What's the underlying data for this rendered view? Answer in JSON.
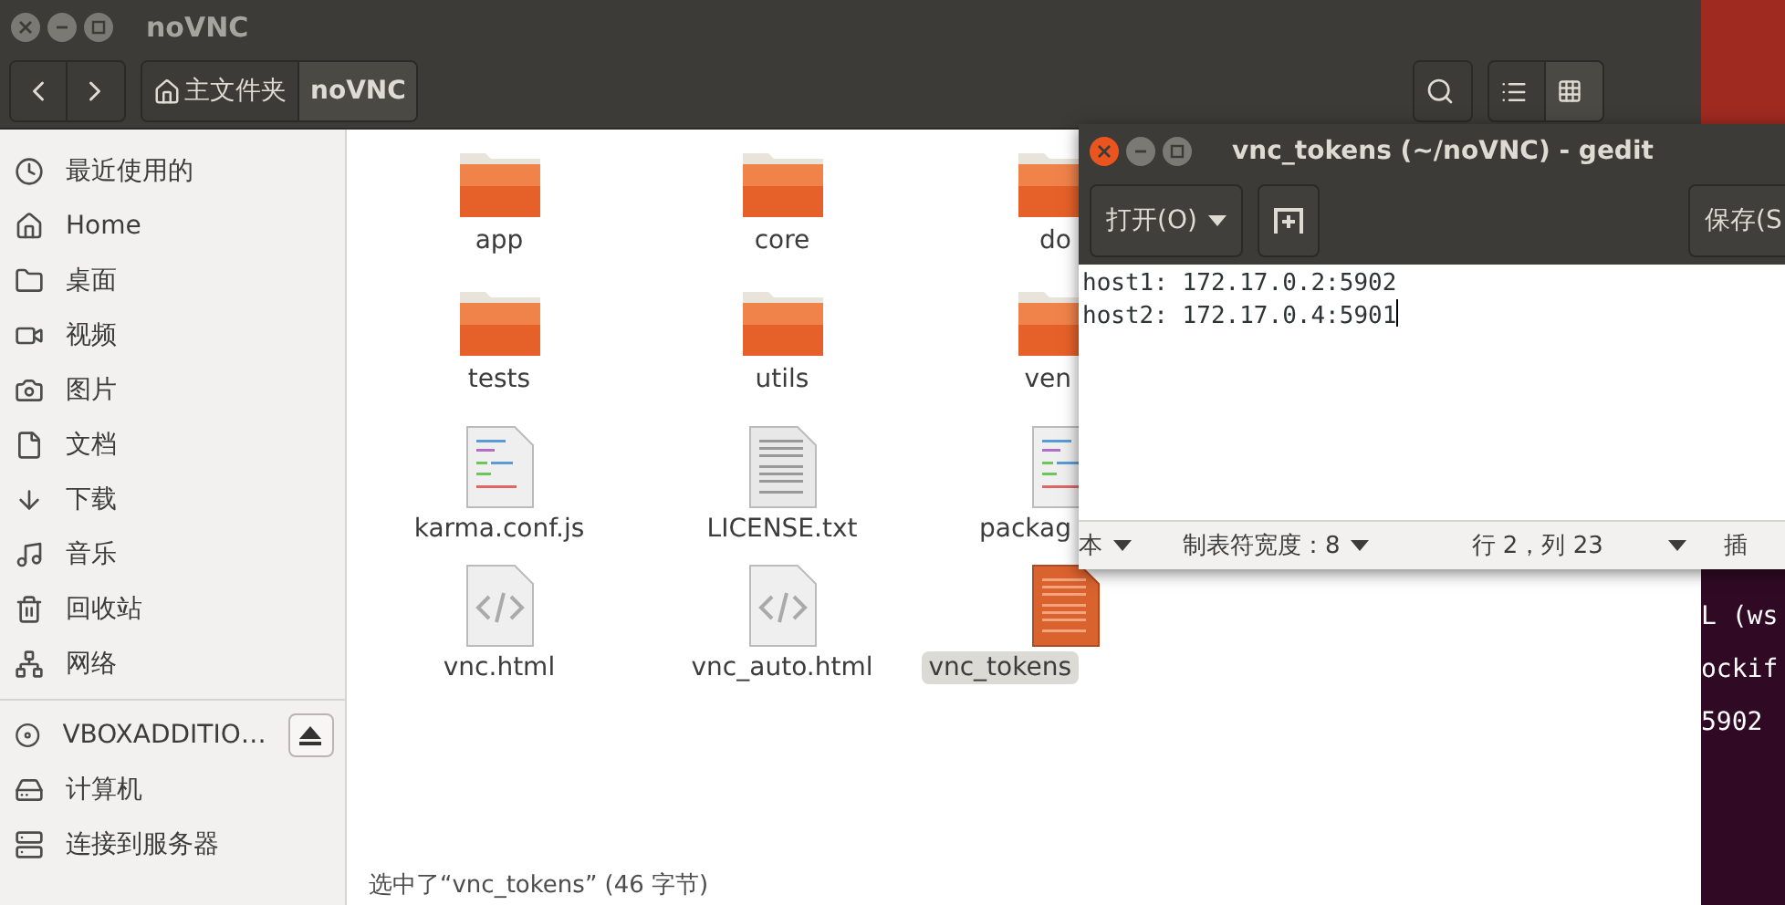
{
  "file_manager": {
    "title": "noVNC",
    "breadcrumb": [
      {
        "label": "主文件夹",
        "kind": "home",
        "selected": false
      },
      {
        "label": "noVNC",
        "kind": "folder",
        "selected": true
      }
    ],
    "view_buttons": [
      {
        "kind": "list",
        "selected": false
      },
      {
        "kind": "grid",
        "selected": true
      }
    ],
    "sidebar": {
      "places": [
        {
          "label": "最近使用的",
          "kind": "recent"
        },
        {
          "label": "Home",
          "kind": "home"
        },
        {
          "label": "桌面",
          "kind": "desktop"
        },
        {
          "label": "视频",
          "kind": "video"
        },
        {
          "label": "图片",
          "kind": "pictures"
        },
        {
          "label": "文档",
          "kind": "documents"
        },
        {
          "label": "下载",
          "kind": "downloads"
        },
        {
          "label": "音乐",
          "kind": "music"
        },
        {
          "label": "回收站",
          "kind": "trash"
        },
        {
          "label": "网络",
          "kind": "network"
        }
      ],
      "devices": [
        {
          "label": "VBOXADDITIO…",
          "kind": "disc",
          "eject": true
        },
        {
          "label": "计算机",
          "kind": "computer",
          "eject": false
        },
        {
          "label": "连接到服务器",
          "kind": "server",
          "eject": false
        }
      ]
    },
    "files": [
      {
        "name": "app",
        "kind": "folder",
        "selected": false
      },
      {
        "name": "core",
        "kind": "folder",
        "selected": false
      },
      {
        "name": "do",
        "kind": "folder",
        "selected": false
      },
      {
        "name": "tests",
        "kind": "folder",
        "selected": false
      },
      {
        "name": "utils",
        "kind": "folder",
        "selected": false
      },
      {
        "name": "ven",
        "kind": "folder",
        "selected": false
      },
      {
        "name": "karma.conf.js",
        "kind": "script",
        "selected": false
      },
      {
        "name": "LICENSE.txt",
        "kind": "text",
        "selected": false
      },
      {
        "name": "packag",
        "kind": "script",
        "selected": false
      },
      {
        "name": "vnc.html",
        "kind": "html",
        "selected": false
      },
      {
        "name": "vnc_auto.html",
        "kind": "html",
        "selected": false
      },
      {
        "name": "vnc_tokens",
        "kind": "text",
        "selected": true
      }
    ],
    "status": "选中了“vnc_tokens” (46 字节)"
  },
  "editor": {
    "title": "vnc_tokens (~/noVNC) - gedit",
    "open_button": "打开(O)",
    "save_button": "保存(S",
    "lines": [
      "host1: 172.17.0.2:5902",
      "host2: 172.17.0.4:5901"
    ],
    "status_items": [
      {
        "kind": "dropdown",
        "label": "本"
      },
      {
        "kind": "dropdown",
        "label": "制表符宽度：8"
      },
      {
        "kind": "text",
        "label": "行 2，列 23"
      },
      {
        "kind": "caret"
      },
      {
        "kind": "text",
        "label": "插"
      }
    ]
  },
  "terminal": {
    "lines": [
      "L (ws",
      "ockif",
      "5902"
    ]
  }
}
